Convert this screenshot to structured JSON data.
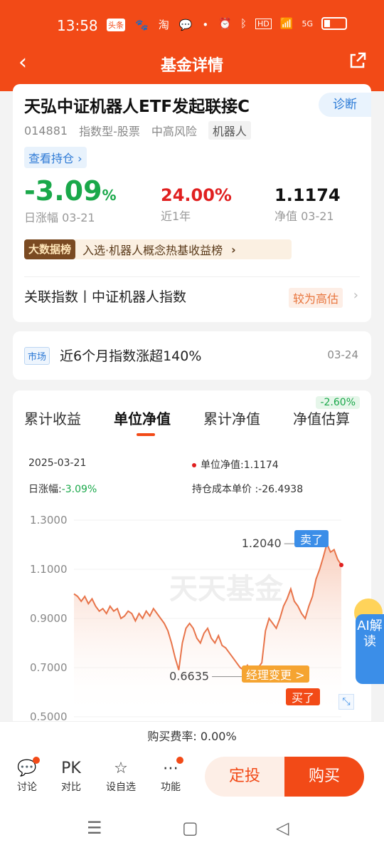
{
  "status_bar": {
    "time": "13:58",
    "icons": [
      "头条",
      "百度",
      "淘",
      "微信",
      "•"
    ],
    "right": [
      "闹钟",
      "蓝牙",
      "HD",
      "wifi",
      "5G",
      "battery"
    ]
  },
  "nav": {
    "title": "基金详情"
  },
  "fund": {
    "name": "天弘中证机器人ETF发起联接C",
    "diagnose": "诊断",
    "code": "014881",
    "type": "指数型-股票",
    "risk": "中高风险",
    "tag": "机器人",
    "view_holdings": "查看持仓 ›",
    "daily_change": "-3.09",
    "daily_change_pct": "%",
    "daily_label": "日涨幅 03-21",
    "year_return": "24.00%",
    "year_label": "近1年",
    "nav_value": "1.1174",
    "nav_label": "净值 03-21",
    "bigdata_badge": "大数据榜",
    "bigdata_text": "入选·机器人概念热基收益榜",
    "related_index": "关联指数丨中证机器人指数",
    "related_tag": "较为高估"
  },
  "market": {
    "tag": "市场",
    "text": "近6个月指数涨超140%",
    "date": "03-24"
  },
  "chart_section": {
    "tabs": [
      "累计收益",
      "单位净值",
      "累计净值",
      "净值估算"
    ],
    "active_tab": 1,
    "est_badge": "-2.60%",
    "date": "2025-03-21",
    "nav_label": "单位净值:1.1174",
    "daily_label": "日涨幅:",
    "daily_value": "-3.09%",
    "cost_label": "持仓成本单价 :-26.4938",
    "watermark": "天天基金",
    "max_label": "1.2040",
    "min_label": "0.6635",
    "sell_label": "卖了",
    "buy_label": "买了",
    "manager_change": "经理变更 >"
  },
  "chart_data": {
    "type": "line",
    "yticks": [
      "1.3000",
      "1.1000",
      "0.9000",
      "0.7000",
      "0.5000"
    ],
    "ylim": [
      0.5,
      1.3
    ],
    "max": 1.204,
    "min": 0.6635,
    "last": 1.1174,
    "series": [
      {
        "values": [
          1.0,
          0.99,
          0.97,
          0.99,
          0.96,
          0.98,
          0.95,
          0.93,
          0.94,
          0.92,
          0.95,
          0.93,
          0.94,
          0.9,
          0.91,
          0.93,
          0.92,
          0.89,
          0.92,
          0.9,
          0.93,
          0.91,
          0.94,
          0.92,
          0.9,
          0.88,
          0.85,
          0.8,
          0.74,
          0.69,
          0.8,
          0.86,
          0.88,
          0.86,
          0.82,
          0.8,
          0.84,
          0.86,
          0.82,
          0.8,
          0.83,
          0.79,
          0.78,
          0.76,
          0.74,
          0.72,
          0.7,
          0.69,
          0.71,
          0.68,
          0.6635,
          0.7,
          0.72,
          0.85,
          0.9,
          0.88,
          0.86,
          0.9,
          0.95,
          0.98,
          1.02,
          0.97,
          0.95,
          0.92,
          0.9,
          0.95,
          0.99,
          1.06,
          1.1,
          1.15,
          1.204,
          1.17,
          1.18,
          1.14,
          1.1174
        ]
      }
    ]
  },
  "footer": {
    "fee": "购买费率: 0.00%",
    "items": [
      "讨论",
      "对比",
      "设自选",
      "功能"
    ],
    "pk_icon": "PK",
    "dingtou": "定投",
    "buy": "购买"
  },
  "ai": "AI解读"
}
